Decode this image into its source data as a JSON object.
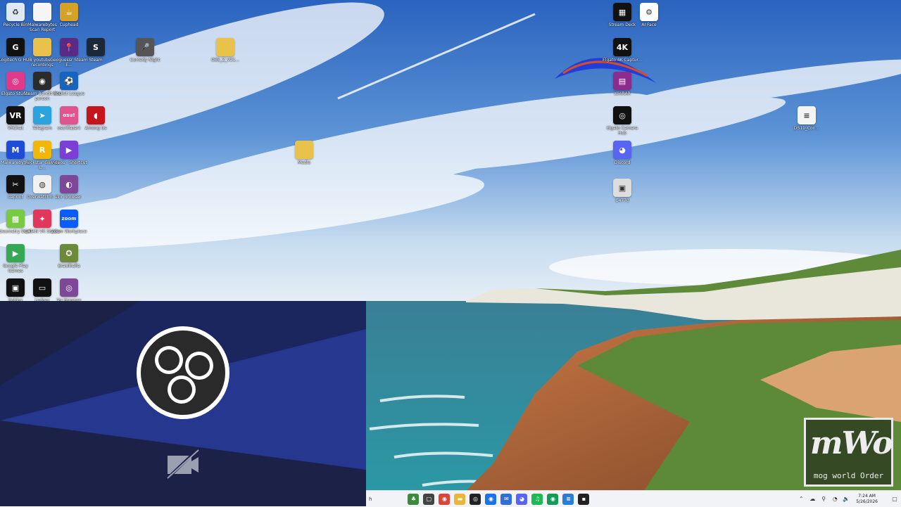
{
  "desktop": {
    "icons": [
      {
        "label": "Recycle Bin",
        "icon": "recycle-bin-icon",
        "bg": "#dfe8f3",
        "glyph": "♻"
      },
      {
        "label": "Malwarebytes Scan Report",
        "icon": "document-icon",
        "bg": "#f5f5f5",
        "glyph": ""
      },
      {
        "label": "Cuphead",
        "icon": "cuphead-icon",
        "bg": "#d5a126",
        "glyph": "☕"
      },
      {
        "label": "Logitech G HUB",
        "icon": "logitech-g-hub-icon",
        "bg": "#111111",
        "glyph": "G"
      },
      {
        "label": "youtube recordings",
        "icon": "folder-icon",
        "bg": "#e8c24a",
        "glyph": ""
      },
      {
        "label": "Geoguessr Steam E...",
        "icon": "geoguessr-icon",
        "bg": "#5a2b86",
        "glyph": "📍"
      },
      {
        "label": "Steam",
        "icon": "steam-icon",
        "bg": "#1b2838",
        "glyph": "S"
      },
      {
        "label": "Comedy Night",
        "icon": "microphone-icon",
        "bg": "#555555",
        "glyph": "🎤"
      },
      {
        "label": "OBS_Z_V21...",
        "icon": "folder-icon",
        "bg": "#e8c24a",
        "glyph": ""
      },
      {
        "label": "Stream Deck",
        "icon": "stream-deck-icon",
        "bg": "#111111",
        "glyph": "▦"
      },
      {
        "label": "AI Face",
        "icon": "ai-face-icon",
        "bg": "#ffffff",
        "glyph": "⚙"
      },
      {
        "label": "Elgato Studio",
        "icon": "elgato-studio-icon",
        "bg": "#e23a8a",
        "glyph": "◎"
      },
      {
        "label": "Steam Bandit this person",
        "icon": "ghost-icon",
        "bg": "#2b2b2b",
        "glyph": "◉"
      },
      {
        "label": "Rocket League",
        "icon": "rocket-league-icon",
        "bg": "#1565c0",
        "glyph": "⚽"
      },
      {
        "label": "Elgato 4K Captur...",
        "icon": "elgato-4k-icon",
        "bg": "#111111",
        "glyph": "4K"
      },
      {
        "label": "WinRAR",
        "icon": "winrar-icon",
        "bg": "#8e2b8e",
        "glyph": "▤"
      },
      {
        "label": "VRChat",
        "icon": "vrchat-icon",
        "bg": "#111111",
        "glyph": "VR"
      },
      {
        "label": "Telegram",
        "icon": "telegram-icon",
        "bg": "#2aa3df",
        "glyph": "➤"
      },
      {
        "label": "osu!(lazer)",
        "icon": "osu-icon",
        "bg": "#e0558f",
        "glyph": "osu!"
      },
      {
        "label": "Among Us",
        "icon": "among-us-icon",
        "bg": "#c4161c",
        "glyph": "◖"
      },
      {
        "label": "Elgato Camera Hub",
        "icon": "elgato-camera-hub-icon",
        "bg": "#111111",
        "glyph": "◎"
      },
      {
        "label": "DS11_Con...",
        "icon": "text-document-icon",
        "bg": "#f4f4f4",
        "glyph": "≡"
      },
      {
        "label": "Malwarebytes",
        "icon": "malwarebytes-icon",
        "bg": "#1f4cd6",
        "glyph": "M"
      },
      {
        "label": "Rockstar Games L...",
        "icon": "rockstar-icon",
        "bg": "#f2b705",
        "glyph": "R"
      },
      {
        "label": "Videos - Shortcut",
        "icon": "videos-icon",
        "bg": "#7b3fd6",
        "glyph": "▶"
      },
      {
        "label": "Media",
        "icon": "folder-icon",
        "bg": "#e8c24a",
        "glyph": ""
      },
      {
        "label": "Discord",
        "icon": "discord-icon",
        "bg": "#5865f2",
        "glyph": "◕"
      },
      {
        "label": "CapCut",
        "icon": "capcut-icon",
        "bg": "#111111",
        "glyph": "✂"
      },
      {
        "label": "Overwatch® 2",
        "icon": "overwatch-icon",
        "bg": "#f0f0f0",
        "glyph": "◍"
      },
      {
        "label": "Tor Browser",
        "icon": "tor-browser-icon",
        "bg": "#7e4798",
        "glyph": "◐"
      },
      {
        "label": "C4770",
        "icon": "film-icon",
        "bg": "#dddddd",
        "glyph": "▣"
      },
      {
        "label": "Geometry Dash",
        "icon": "geometry-dash-icon",
        "bg": "#7ac943",
        "glyph": "▩"
      },
      {
        "label": "CATAN VR Studio",
        "icon": "catan-icon",
        "bg": "#e0375a",
        "glyph": "✦"
      },
      {
        "label": "Zoom Workplace",
        "icon": "zoom-icon",
        "bg": "#0b5cff",
        "glyph": "zoom"
      },
      {
        "label": "Google Play Games",
        "icon": "google-play-games-icon",
        "bg": "#34a853",
        "glyph": "▶"
      },
      {
        "label": "Brawlhalla",
        "icon": "brawlhalla-icon",
        "bg": "#6d8a3a",
        "glyph": "✪"
      },
      {
        "label": "Roblox",
        "icon": "roblox-icon",
        "bg": "#111111",
        "glyph": "▣"
      },
      {
        "label": "Ledger",
        "icon": "ledger-icon",
        "bg": "#111111",
        "glyph": "▭"
      },
      {
        "label": "Tor Browser",
        "icon": "tor-browser-icon",
        "bg": "#7e4798",
        "glyph": "◎"
      }
    ]
  },
  "obs_overlay": {
    "logo": "obs-logo-icon",
    "status_icon": "camera-off-icon"
  },
  "taskbar": {
    "search_placeholder": "h",
    "apps": [
      {
        "icon": "widgets-icon",
        "bg": "#3c8a3c",
        "glyph": "♣"
      },
      {
        "icon": "task-view-icon",
        "bg": "#444444",
        "glyph": "▢"
      },
      {
        "icon": "chrome-icon",
        "bg": "#db4437",
        "glyph": "◉"
      },
      {
        "icon": "file-explorer-icon",
        "bg": "#e8b73a",
        "glyph": "▬"
      },
      {
        "icon": "obs-icon",
        "bg": "#222222",
        "glyph": "◎"
      },
      {
        "icon": "chrome-icon",
        "bg": "#1a73e8",
        "glyph": "◉"
      },
      {
        "icon": "mail-icon",
        "bg": "#2f6fd6",
        "glyph": "✉"
      },
      {
        "icon": "discord-icon",
        "bg": "#5865f2",
        "glyph": "◕"
      },
      {
        "icon": "spotify-icon",
        "bg": "#1db954",
        "glyph": "♫"
      },
      {
        "icon": "chrome-icon",
        "bg": "#0f9d58",
        "glyph": "◉"
      },
      {
        "icon": "notepad-icon",
        "bg": "#2b7cd3",
        "glyph": "≡"
      },
      {
        "icon": "sticky-notes-icon",
        "bg": "#222222",
        "glyph": "▪"
      }
    ],
    "tray": {
      "time": "7:24 AM",
      "date": "5/26/2026"
    }
  },
  "watermark": {
    "big": "mWo",
    "small": "mog world Order"
  },
  "colors": {
    "sky_top": "#2f6fc8",
    "sky_bottom": "#cfe0f1",
    "sea": "#2f8ba0",
    "cliff": "#b86a3a",
    "grass": "#5f8a3a",
    "obs_bg": "#1c2147",
    "obs_band": "#243a8f"
  }
}
